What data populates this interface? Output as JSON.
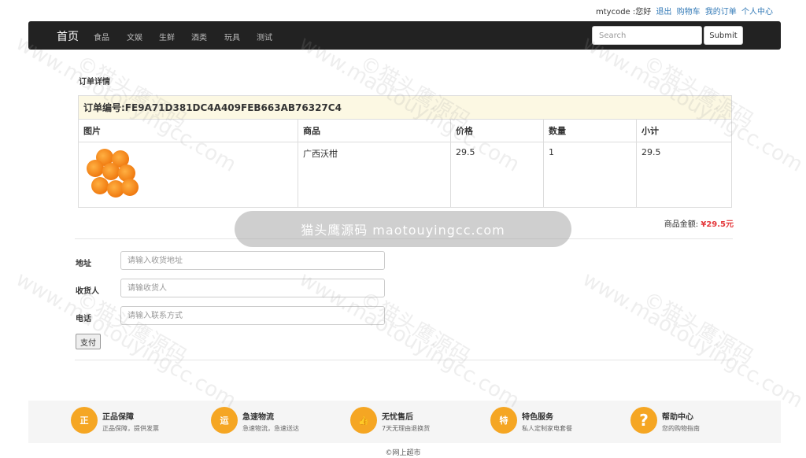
{
  "topbar": {
    "greeting": "mtycode :您好",
    "links": [
      "退出",
      "购物车",
      "我的订单",
      "个人中心"
    ]
  },
  "nav": {
    "brand": "首页",
    "items": [
      "食品",
      "文娱",
      "生鲜",
      "酒类",
      "玩具",
      "测试"
    ],
    "search_placeholder": "Search",
    "submit_label": "Submit"
  },
  "order": {
    "section_title": "订单详情",
    "order_id": "订单编号:FE9A71D381DC4A409FEB663AB76327C4",
    "headers": [
      "图片",
      "商品",
      "价格",
      "数量",
      "小计"
    ],
    "items": [
      {
        "image": "orange",
        "name": "广西沃柑",
        "price": "29.5",
        "qty": "1",
        "subtotal": "29.5"
      }
    ],
    "total_label": "商品金额:",
    "total_value": "¥29.5元"
  },
  "form": {
    "address_label": "地址",
    "address_placeholder": "请输入收货地址",
    "receiver_label": "收货人",
    "receiver_placeholder": "请输收货人",
    "phone_label": "电话",
    "phone_placeholder": "请输入联系方式",
    "pay_label": "支付"
  },
  "footer": {
    "items": [
      {
        "icon": "正",
        "title": "正品保障",
        "desc": "正品保障，提供发票"
      },
      {
        "icon": "运",
        "title": "急速物流",
        "desc": "急速物流，急速送达"
      },
      {
        "icon": "👍",
        "title": "无忧售后",
        "desc": "7天无理由退换货"
      },
      {
        "icon": "特",
        "title": "特色服务",
        "desc": "私人定制家电套餐"
      },
      {
        "icon": "?",
        "title": "帮助中心",
        "desc": "您的购物指南"
      }
    ],
    "copyright": "©网上超市"
  },
  "watermark": {
    "pill": "猫头鹰源码 maotouyingcc.com",
    "text": "©猫头鹰源码",
    "url": "www.maotouyingcc.com"
  },
  "colors": {
    "accent": "#f5a623",
    "price": "#e4393c",
    "navbar": "#222222",
    "highlight_row": "#fcf8e3"
  }
}
